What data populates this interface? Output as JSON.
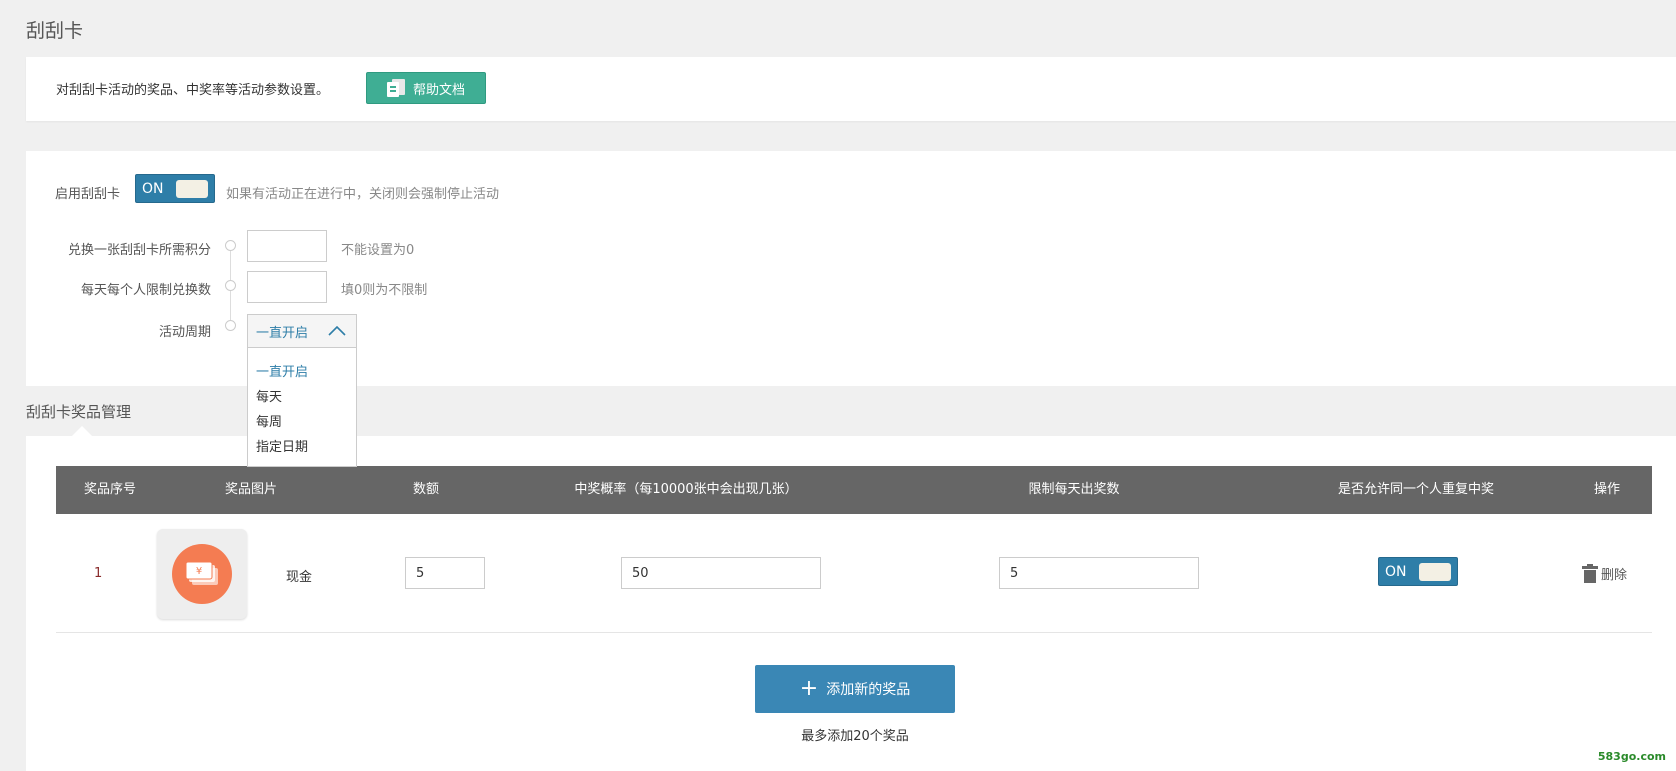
{
  "page": {
    "title": "刮刮卡"
  },
  "intro": {
    "text": "对刮刮卡活动的奖品、中奖率等活动参数设置。",
    "help_label": "帮助文档"
  },
  "settings": {
    "enable_label": "启用刮刮卡",
    "enable_switch": "ON",
    "enable_hint": "如果有活动正在进行中，关闭则会强制停止活动",
    "points_label": "兑换一张刮刮卡所需积分",
    "points_value": "",
    "points_hint": "不能设置为0",
    "daily_limit_label": "每天每个人限制兑换数",
    "daily_limit_value": "",
    "daily_limit_hint": "填0则为不限制",
    "period_label": "活动周期",
    "period_selected": "一直开启",
    "period_options": [
      "一直开启",
      "每天",
      "每周",
      "指定日期"
    ]
  },
  "prizes": {
    "section_title": "刮刮卡奖品管理",
    "columns": [
      "奖品序号",
      "奖品图片",
      "数额",
      "中奖概率（每10000张中会出现几张）",
      "限制每天出奖数",
      "是否允许同一个人重复中奖",
      "操作"
    ],
    "rows": [
      {
        "index": "1",
        "image_icon": "cash-icon",
        "name": "现金",
        "amount": "5",
        "probability": "50",
        "daily_limit": "5",
        "repeat_switch": "ON",
        "delete_label": "删除"
      }
    ],
    "add_label": "添加新的奖品",
    "add_note": "最多添加20个奖品"
  },
  "watermark": "583go.com",
  "colors": {
    "switch": "#2e7ea8",
    "help_button": "#3fae94",
    "add_button": "#3a87b5",
    "table_header": "#666666",
    "prize_circle": "#f47c52"
  }
}
